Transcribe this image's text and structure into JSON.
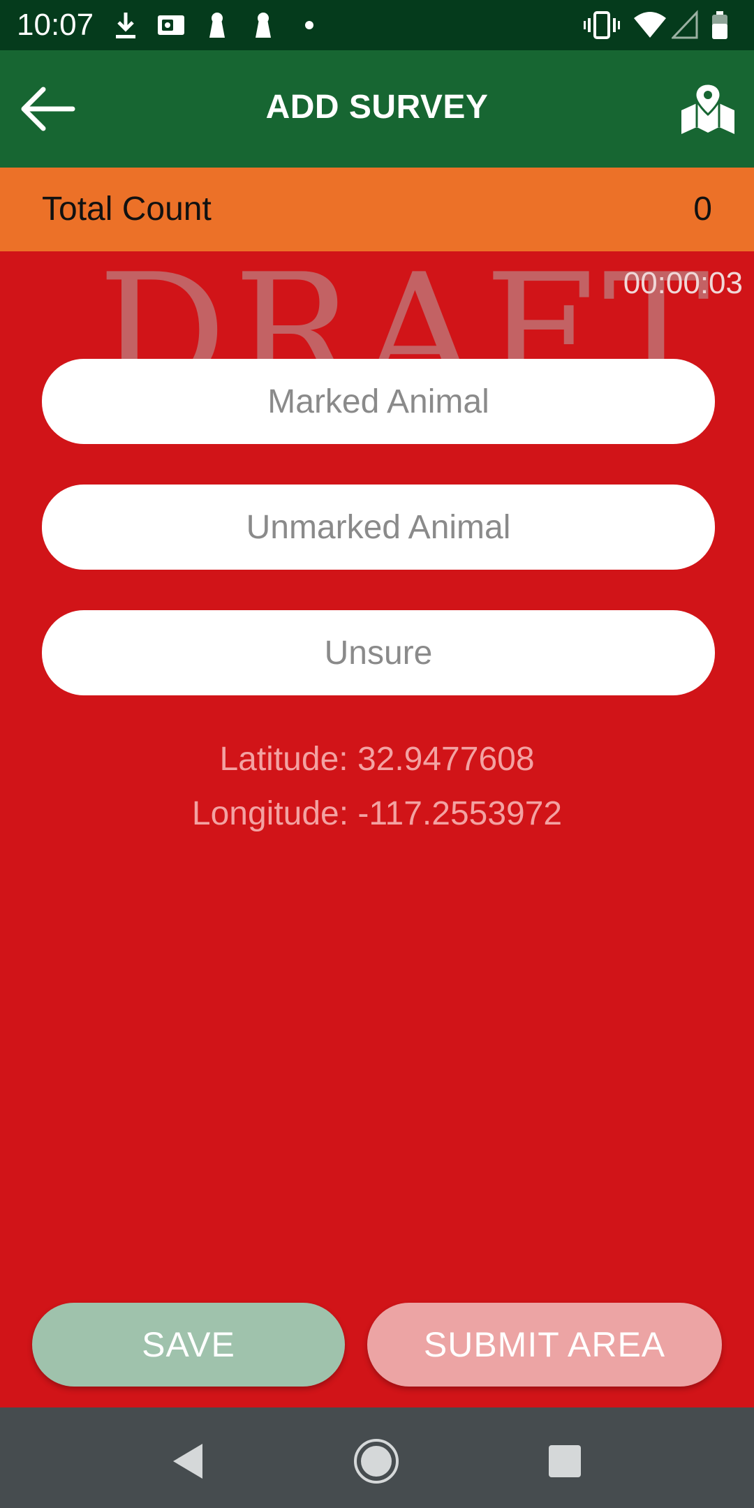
{
  "status_bar": {
    "time": "10:07",
    "left_icons": [
      "download-icon",
      "cast-icon",
      "keyhole-icon",
      "keyhole-icon",
      "dot-icon"
    ],
    "right_icons": [
      "vibrate-icon",
      "wifi-icon",
      "signal-icon",
      "battery-icon"
    ]
  },
  "app_bar": {
    "title": "ADD SURVEY",
    "back_icon": "arrow-left-icon",
    "map_icon": "map-pin-icon",
    "color": "#176632"
  },
  "count_bar": {
    "label": "Total Count",
    "value": "0",
    "color": "#ec7128"
  },
  "watermark": "DRAFT",
  "timer": "00:00:03",
  "inputs": {
    "marked_placeholder": "Marked Animal",
    "unmarked_placeholder": "Unmarked Animal",
    "unsure_placeholder": "Unsure"
  },
  "location": {
    "latitude": "Latitude: 32.9477608",
    "longitude": "Longitude: -117.2553972"
  },
  "actions": {
    "save_label": "SAVE",
    "submit_label": "SUBMIT AREA"
  },
  "background_color": "#d11418",
  "nav_bar": {
    "icons": [
      "nav-back-icon",
      "nav-home-icon",
      "nav-recents-icon"
    ]
  }
}
